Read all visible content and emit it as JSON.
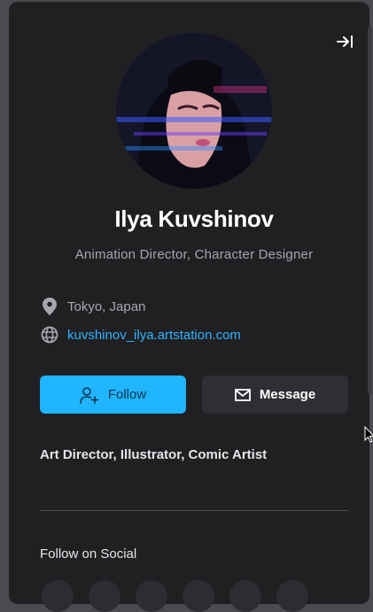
{
  "profile": {
    "name": "Ilya Kuvshinov",
    "subtitle": "Animation Director, Character Designer",
    "location": "Tokyo, Japan",
    "website": "kuvshinov_ilya.artstation.com",
    "bio": "Art Director, Illustrator, Comic Artist"
  },
  "actions": {
    "follow_label": "Follow",
    "message_label": "Message"
  },
  "social": {
    "title": "Follow on Social"
  },
  "colors": {
    "panel_bg": "#202023",
    "accent": "#1fb6ff",
    "link": "#2fb3ff",
    "secondary_button": "#2e2e33"
  },
  "icons": {
    "collapse": "collapse-right-icon",
    "location": "map-pin-icon",
    "website": "globe-icon",
    "follow": "user-plus-icon",
    "message": "envelope-icon"
  }
}
